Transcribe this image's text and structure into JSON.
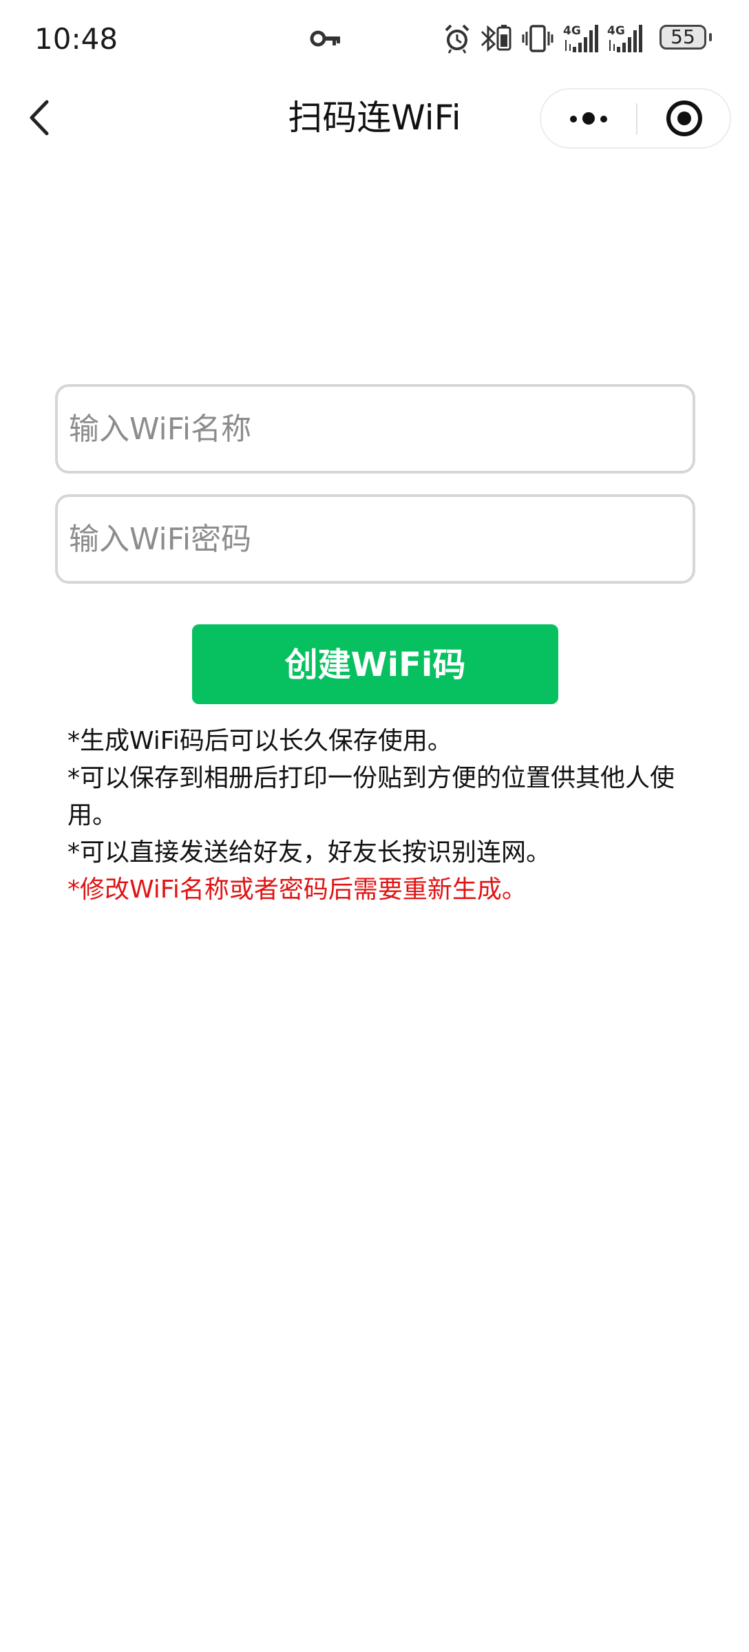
{
  "status_bar": {
    "time": "10:48",
    "network_1": "4G",
    "network_2": "4G",
    "battery": "55",
    "icons": [
      "vpn-key-icon",
      "alarm-icon",
      "bluetooth-icon",
      "vibrate-icon",
      "signal-icon",
      "signal-icon",
      "battery-icon"
    ]
  },
  "nav": {
    "title": "扫码连WiFi",
    "back_icon": "chevron-left-icon",
    "more_icon": "more-dots-icon",
    "close_icon": "target-circle-icon"
  },
  "form": {
    "ssid_placeholder": "输入WiFi名称",
    "ssid_value": "",
    "password_placeholder": "输入WiFi密码",
    "password_value": "",
    "submit_label": "创建WiFi码"
  },
  "notes": [
    "*生成WiFi码后可以长久保存使用。",
    "*可以保存到相册后打印一份贴到方便的位置供其他人使用。",
    "*可以直接发送给好友，好友长按识别连网。",
    "*修改WiFi名称或者密码后需要重新生成。"
  ],
  "colors": {
    "primary_button": "#07c160",
    "warning_text": "#e01414",
    "input_border": "#d6d6d6",
    "placeholder": "#8c8c8c"
  }
}
